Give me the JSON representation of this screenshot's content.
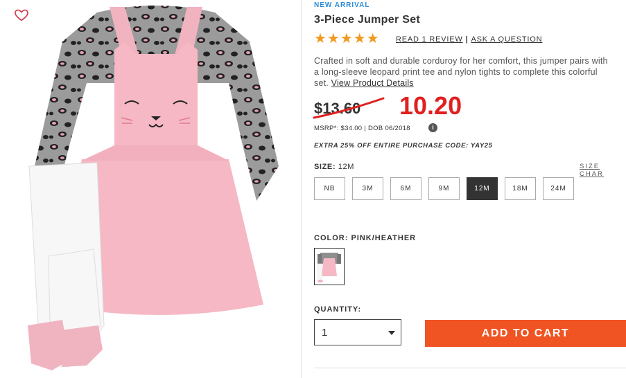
{
  "image_panel": {
    "wishlist_icon": "heart-outline-icon"
  },
  "product": {
    "badge": "NEW ARRIVAL",
    "title": "3-Piece Jumper Set",
    "rating_stars": "★★★★★",
    "rating": 5,
    "review_link": "READ 1 REVIEW",
    "separator": "|",
    "question_link": "ASK A QUESTION",
    "description": "Crafted in soft and durable corduroy for her comfort, this jumper pairs with a long-sleeve leopard print tee and nylon tights to complete this colorful set.",
    "details_link": "View Product Details",
    "old_price": "$13.60",
    "new_price": "10.20",
    "msrp_line": "MSRP*: $34.00 | DOB 06/2018",
    "info_icon": "i",
    "promo": "EXTRA 25% OFF ENTIRE PURCHASE CODE: YAY25"
  },
  "size": {
    "label": "SIZE:",
    "selected": "12M",
    "chart_link": "SIZE CHAR",
    "options": [
      "NB",
      "3M",
      "6M",
      "9M",
      "12M",
      "18M",
      "24M"
    ]
  },
  "color": {
    "label": "COLOR: PINK/HEATHER"
  },
  "quantity": {
    "label": "QUANTITY:",
    "value": "1"
  },
  "cart": {
    "button_label": "ADD TO CART",
    "accent": "#f05423"
  },
  "colors": {
    "price_red": "#e02020",
    "star": "#f19a1f",
    "badge_blue": "#2b8bd6"
  }
}
